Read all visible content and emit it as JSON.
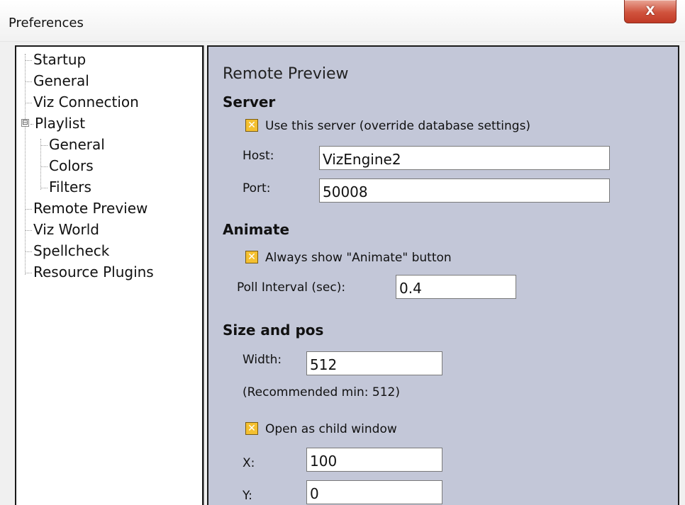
{
  "window": {
    "title": "Preferences",
    "close_label": "X"
  },
  "tree": {
    "items": [
      {
        "label": "Startup"
      },
      {
        "label": "General"
      },
      {
        "label": "Viz Connection"
      },
      {
        "label": "Playlist",
        "expander": "⊟"
      },
      {
        "label": "General"
      },
      {
        "label": "Colors"
      },
      {
        "label": "Filters"
      },
      {
        "label": "Remote Preview"
      },
      {
        "label": "Viz World"
      },
      {
        "label": "Spellcheck"
      },
      {
        "label": "Resource Plugins"
      }
    ]
  },
  "panel": {
    "title": "Remote Preview",
    "server": {
      "heading": "Server",
      "use_server_label": "Use this server (override database settings)",
      "host_label": "Host:",
      "host_value": "VizEngine2",
      "port_label": "Port:",
      "port_value": "50008"
    },
    "animate": {
      "heading": "Animate",
      "show_button_label": "Always show \"Animate\" button",
      "poll_label": "Poll Interval (sec):",
      "poll_value": "0.4"
    },
    "size": {
      "heading": "Size and pos",
      "width_label": "Width:",
      "width_value": "512",
      "recommended": "(Recommended min: 512)",
      "child_window_label": "Open as child window",
      "x_label": "X:",
      "x_value": "100",
      "y_label": "Y:",
      "y_value": "0"
    },
    "checkbox_mark": "✕"
  }
}
